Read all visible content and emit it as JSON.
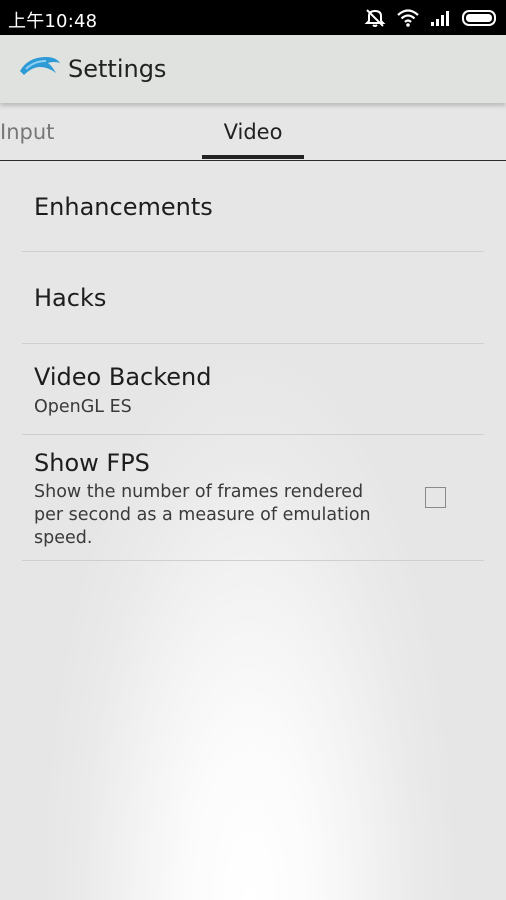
{
  "status_bar": {
    "time": "上午10:48"
  },
  "action_bar": {
    "title": "Settings",
    "logo": "dolphin-logo-icon"
  },
  "tabs": [
    {
      "label": "Input",
      "selected": false
    },
    {
      "label": "Video",
      "selected": true
    }
  ],
  "preferences": [
    {
      "title": "Enhancements"
    },
    {
      "title": "Hacks"
    },
    {
      "title": "Video Backend",
      "summary": "OpenGL ES"
    },
    {
      "title": "Show FPS",
      "summary": "Show the number of frames rendered per second as a measure of emulation speed.",
      "checked": false
    }
  ],
  "colors": {
    "status_bar": "#000000",
    "action_bar": "#dfe2de",
    "background": "#e6e6e6",
    "logo_blue": "#2e9bd6"
  },
  "icons": [
    "mute-icon",
    "wifi-icon",
    "signal-icon",
    "battery-icon"
  ]
}
